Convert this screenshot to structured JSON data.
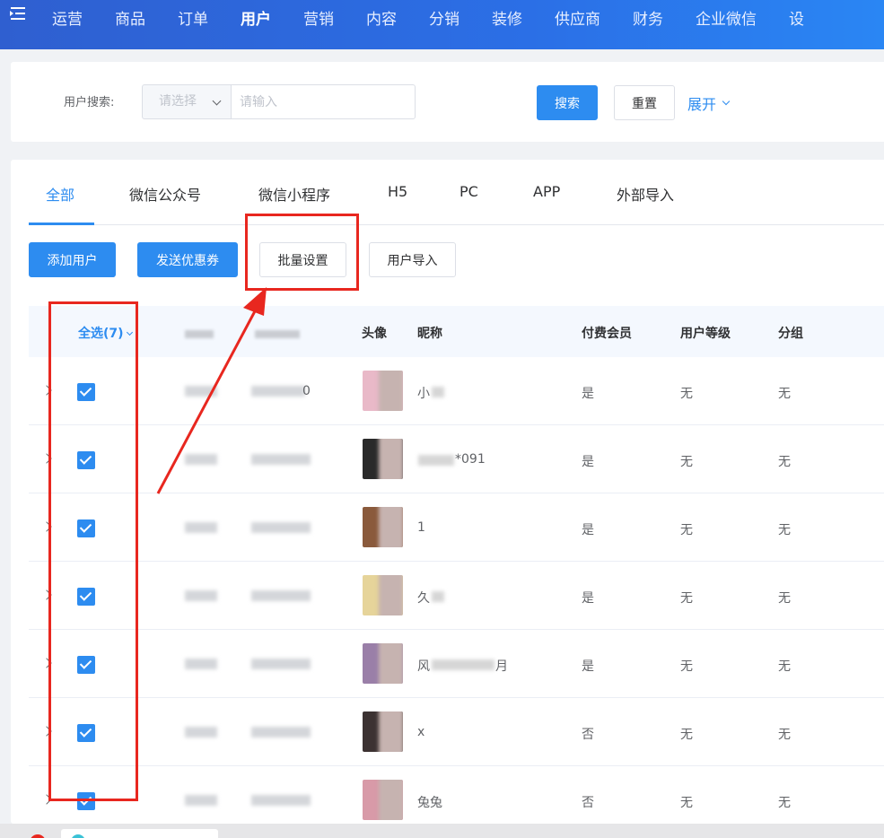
{
  "nav": {
    "items": [
      "运营",
      "商品",
      "订单",
      "用户",
      "营销",
      "内容",
      "分销",
      "装修",
      "供应商",
      "财务",
      "企业微信",
      "设"
    ],
    "active_index": 3
  },
  "search": {
    "label": "用户搜索:",
    "select_placeholder": "请选择",
    "input_placeholder": "请输入",
    "search_button": "搜索",
    "reset_button": "重置",
    "expand_link": "展开"
  },
  "tabs": [
    "全部",
    "微信公众号",
    "微信小程序",
    "H5",
    "PC",
    "APP",
    "外部导入"
  ],
  "actions": {
    "add_user": "添加用户",
    "send_coupon": "发送优惠券",
    "batch_settings": "批量设置",
    "import_users": "用户导入"
  },
  "table": {
    "headers": {
      "select_all": "全选(7)",
      "avatar": "头像",
      "nickname": "昵称",
      "paid_member": "付费会员",
      "user_level": "用户等级",
      "group": "分组"
    },
    "rows": [
      {
        "nickname": "小",
        "paid_member": "是",
        "user_level": "无",
        "group": "无",
        "id_suffix": "0"
      },
      {
        "nickname": "*091",
        "paid_member": "是",
        "user_level": "无",
        "group": "无",
        "id_suffix": ""
      },
      {
        "nickname": "1",
        "paid_member": "是",
        "user_level": "无",
        "group": "无",
        "id_suffix": ""
      },
      {
        "nickname": "久",
        "paid_member": "是",
        "user_level": "无",
        "group": "无",
        "id_suffix": ""
      },
      {
        "nickname": "风",
        "nickname_end": "月",
        "paid_member": "是",
        "user_level": "无",
        "group": "无",
        "id_suffix": ""
      },
      {
        "nickname": "x",
        "paid_member": "否",
        "user_level": "无",
        "group": "无",
        "id_suffix": ""
      },
      {
        "nickname": "兔兔",
        "paid_member": "否",
        "user_level": "无",
        "group": "无",
        "id_suffix": ""
      }
    ]
  },
  "colors": {
    "primary": "#2d8cf0",
    "annotation": "#e8271f",
    "nav_bg": "#2b6fe6"
  }
}
